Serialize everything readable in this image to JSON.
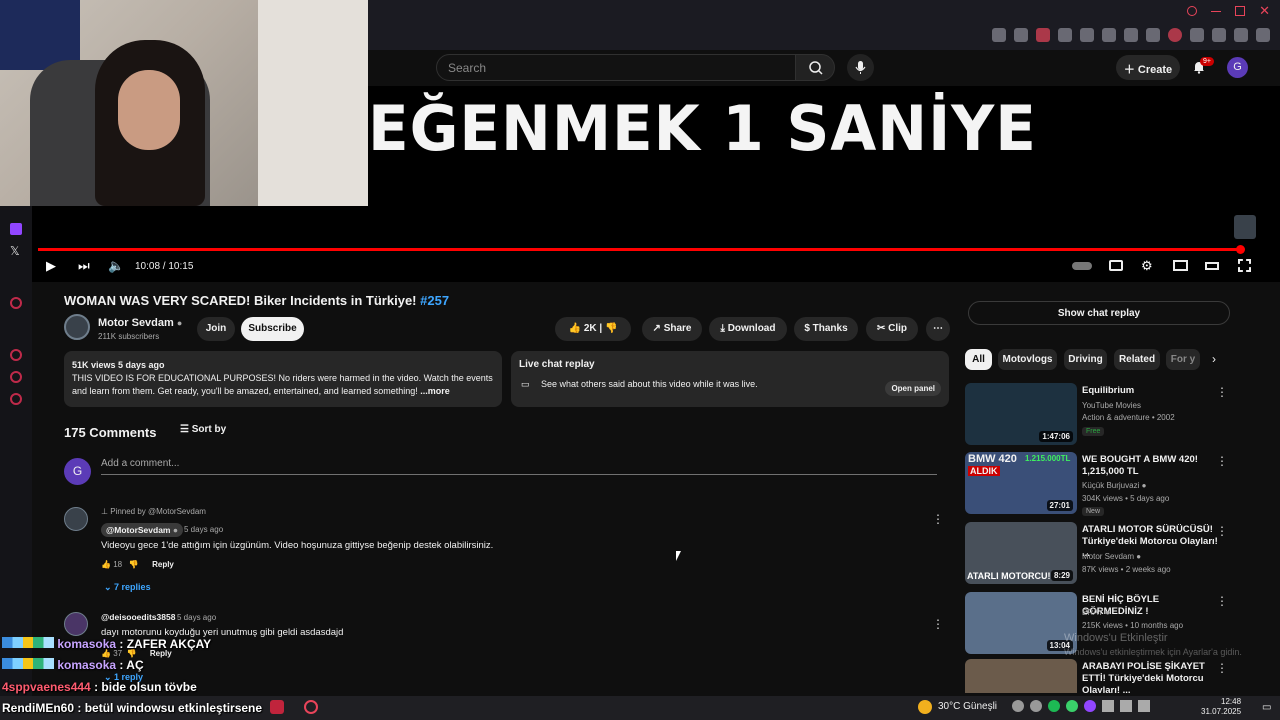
{
  "browser": {
    "accent": "#e8445a"
  },
  "header": {
    "search_placeholder": "Search",
    "create_label": "Create",
    "notif_count": "9+",
    "avatar_letter": "G"
  },
  "video": {
    "overlay_text": "EĞENMEK 1 SANİYE",
    "time": "10:08 / 10:15",
    "progress_fraction": 0.99,
    "title": "WOMAN WAS VERY SCARED! Biker Incidents in Türkiye!",
    "title_tag": "#257"
  },
  "channel": {
    "name": "Motor Sevdam",
    "subs": "211K subscribers",
    "join": "Join",
    "subscribe": "Subscribe"
  },
  "actions": {
    "likes": "2K",
    "share": "Share",
    "download": "Download",
    "thanks": "Thanks",
    "clip": "Clip"
  },
  "description": {
    "meta": "51K views  5 days ago",
    "text": "THIS VIDEO IS FOR EDUCATIONAL PURPOSES! No riders were harmed in the video. Watch the events and learn from them. Get ready, you'll be amazed, entertained, and learned something!",
    "more": "...more"
  },
  "livechat": {
    "title": "Live chat replay",
    "text": "See what others said about this video while it was live.",
    "open": "Open panel"
  },
  "comments": {
    "count": "175 Comments",
    "sort": "Sort by",
    "add_placeholder": "Add a comment...",
    "add_avatar": "G",
    "pinned_label": "Pinned by @MotorSevdam",
    "items": [
      {
        "author": "@MotorSevdam",
        "time": "5 days ago",
        "text": "Videoyu gece 1'de attığım için üzgünüm. Video hoşunuza gittiyse beğenip destek olabilirsiniz.",
        "likes": "18",
        "reply": "Reply",
        "replies": "7 replies"
      },
      {
        "author": "@deisooedits3858",
        "time": "5 days ago",
        "text": "dayı motorunu koyduğu yeri unutmuş gibi geldi asdasdajd",
        "likes": "37",
        "reply": "Reply",
        "replies": "1 reply"
      }
    ]
  },
  "sidebar": {
    "show_chat": "Show chat replay",
    "chips": [
      "All",
      "Motovlogs",
      "Driving",
      "Related",
      "For y"
    ],
    "recs": [
      {
        "title": "Equilibrium",
        "channel": "YouTube Movies",
        "meta": "Action & adventure • 2002",
        "badge": "Free",
        "duration": "1:47:06",
        "color": "#1d3140"
      },
      {
        "title": "WE BOUGHT A BMW 420! 1,215,000 TL",
        "channel": "Küçük Burjuvazi",
        "meta": "304K views • 5 days ago",
        "badge": "New",
        "duration": "27:01",
        "color": "#3a4f78"
      },
      {
        "title": "ATARLI MOTOR SÜRÜCÜSÜ! Türkiye'deki Motorcu Olayları! ...",
        "channel": "Motor Sevdam",
        "meta": "87K views • 2 weeks ago",
        "badge": "",
        "duration": "8:29",
        "color": "#48505a"
      },
      {
        "title": "BENİ HİÇ BÖYLE GÖRMEDİNİZ !",
        "channel": "ERAY",
        "meta": "215K views • 10 months ago",
        "badge": "",
        "duration": "13:04",
        "color": "#5a6f8a"
      },
      {
        "title": "ARABAYI POLİSE ŞİKAYET ETTİ! Türkiye'deki Motorcu Olayları! ...",
        "channel": "",
        "meta": "",
        "badge": "",
        "duration": "",
        "color": "#6b5b4b"
      }
    ],
    "thumb_text": [
      "BMW 420",
      "1.215.000TL",
      "ALDIK",
      "ATARLI MOTORCU!"
    ]
  },
  "chat_overlay": [
    {
      "user": "komasoka",
      "msg": ": ZAFER AKÇAY",
      "emotes": true
    },
    {
      "user": "komasoka",
      "msg": ": AÇ",
      "emotes": true
    },
    {
      "user": "4sppvaenes444",
      "msg": ": bide olsun tövbe",
      "emotes": false
    },
    {
      "user": "RendiMEn60",
      "msg": ": betül windowsu etkinleştirsene",
      "emotes": false
    }
  ],
  "watermark": {
    "line1": "Windows'u Etkinleştir",
    "line2": "Windows'u etkinleştirmek için Ayarlar'a gidin."
  },
  "taskbar": {
    "weather": "30°C  Güneşli",
    "time": "12:48",
    "date": "31.07.2025"
  }
}
